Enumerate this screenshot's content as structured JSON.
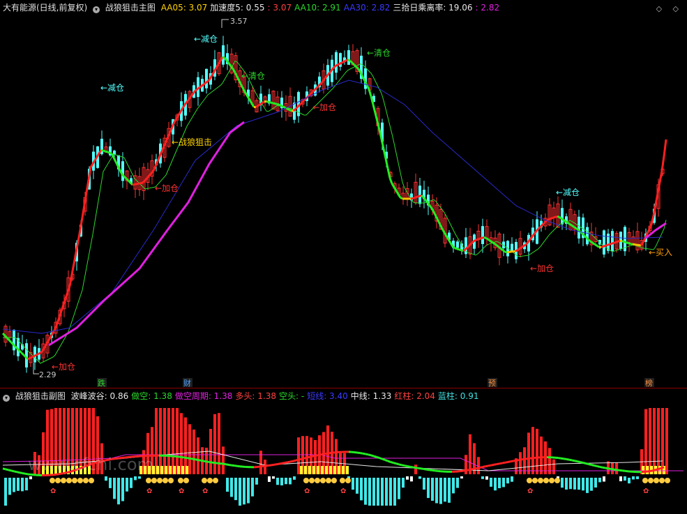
{
  "main_header": {
    "title": "大有能源(日线,前复权)",
    "indicator": "战狼狙击主图",
    "items": [
      {
        "label": "AA05:",
        "value": "3.07",
        "color": "y"
      },
      {
        "label": "加速度5:",
        "value": "0.55",
        "color": "w"
      },
      {
        "label": ":",
        "value": "3.07",
        "color": "r"
      },
      {
        "label": "AA10:",
        "value": "2.91",
        "color": "g"
      },
      {
        "label": "AA30:",
        "value": "2.82",
        "color": "b"
      },
      {
        "label": "三拾日乘离率:",
        "value": "19.06",
        "color": "w"
      },
      {
        "label": ":",
        "value": "2.82",
        "color": "m"
      }
    ]
  },
  "window_controls": "◇ ◇",
  "sub_header": {
    "indicator": "战狼狙击副图",
    "items": [
      {
        "label": "波峰波谷:",
        "value": "0.86",
        "color": "w"
      },
      {
        "label": "做空:",
        "value": "1.38",
        "color": "g"
      },
      {
        "label": "做空周期:",
        "value": "1.38",
        "color": "m"
      },
      {
        "label": "多头:",
        "value": "1.38",
        "color": "r"
      },
      {
        "label": "空头:",
        "value": "-",
        "color": "g"
      },
      {
        "label": "短线:",
        "value": "3.40",
        "color": "b"
      },
      {
        "label": "中线:",
        "value": "1.33",
        "color": "w"
      },
      {
        "label": "红柱:",
        "value": "2.04",
        "color": "r"
      },
      {
        "label": "蓝柱:",
        "value": "0.91",
        "color": "c"
      }
    ]
  },
  "price_labels": {
    "high": "3.57",
    "low": "2.29"
  },
  "annotations": {
    "jiancang": "←减仓",
    "qingcang": "←清仓",
    "jiacang": "←加仓",
    "zhanlang": "←战狼狙击",
    "mairu": "←买入"
  },
  "event_markers": [
    "跌",
    "财",
    "预",
    "榜"
  ],
  "watermark": "www.cfchi.com",
  "colors": {
    "up": "#ff3232",
    "down": "#54ffff",
    "aa05": "#ffd200",
    "aa10": "#2bd62b",
    "aa30": "#2a2acc",
    "magenta": "#e020e0"
  }
}
